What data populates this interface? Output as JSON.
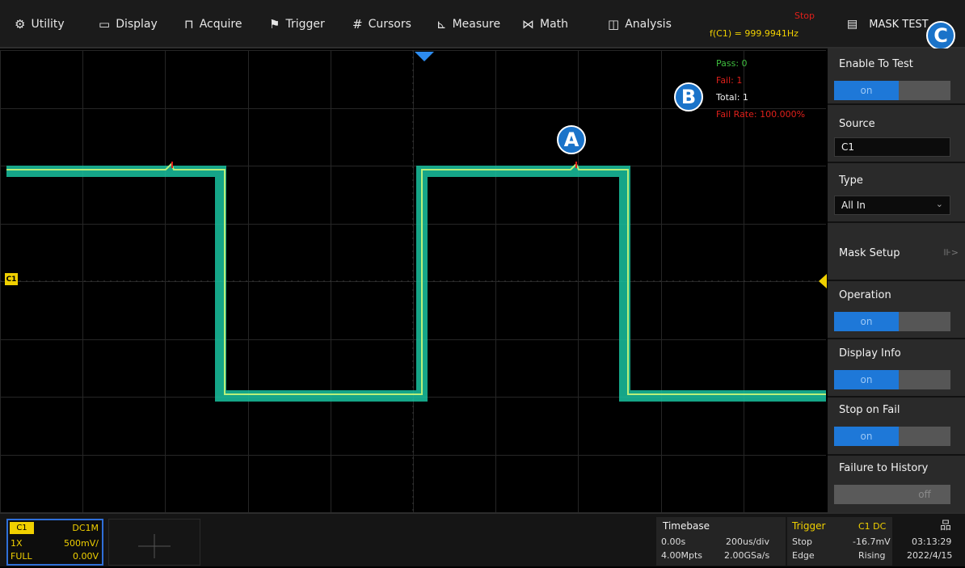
{
  "menu": {
    "items": [
      {
        "label": "Utility",
        "icon": "gear-icon",
        "glyph": "⚙"
      },
      {
        "label": "Display",
        "icon": "monitor-icon",
        "glyph": "▭"
      },
      {
        "label": "Acquire",
        "icon": "acquire-icon",
        "glyph": "⊓"
      },
      {
        "label": "Trigger",
        "icon": "flag-icon",
        "glyph": "⚑"
      },
      {
        "label": "Cursors",
        "icon": "cursors-icon",
        "glyph": "#"
      },
      {
        "label": "Measure",
        "icon": "measure-icon",
        "glyph": "⊾"
      },
      {
        "label": "Math",
        "icon": "math-icon",
        "glyph": "⋈"
      },
      {
        "label": "Analysis",
        "icon": "analysis-icon",
        "glyph": "◫"
      }
    ]
  },
  "status": {
    "run_state": "Stop",
    "frequency": "f(C1) = 999.9941Hz"
  },
  "panel": {
    "title": "MASK TEST",
    "enable_to_test": {
      "label": "Enable To Test",
      "on": "on",
      "off": ""
    },
    "source": {
      "label": "Source",
      "value": "C1"
    },
    "type": {
      "label": "Type",
      "value": "All In"
    },
    "mask_setup": {
      "label": "Mask Setup",
      "arrow": "⊪>"
    },
    "operation": {
      "label": "Operation",
      "on": "on",
      "off": ""
    },
    "display_info": {
      "label": "Display Info",
      "on": "on",
      "off": ""
    },
    "stop_on_fail": {
      "label": "Stop on Fail",
      "on": "on",
      "off": ""
    },
    "failure_to_history": {
      "label": "Failure to History",
      "on": "",
      "off": "off"
    }
  },
  "mask_stats": {
    "pass": "Pass: 0",
    "fail": "Fail: 1",
    "total": "Total: 1",
    "fail_rate": "Fail Rate: 100.000%"
  },
  "callouts": {
    "a": "A",
    "b": "B",
    "c": "C"
  },
  "channel": {
    "name": "C1",
    "coupling": "DC1M",
    "probe": "1X",
    "scale": "500mV/",
    "bandwidth": "FULL",
    "offset": "0.00V"
  },
  "timebase": {
    "label": "Timebase",
    "delay": "0.00s",
    "scale": "200us/div",
    "memory": "4.00Mpts",
    "sample_rate": "2.00GSa/s"
  },
  "trigger": {
    "label": "Trigger",
    "source": "C1 DC",
    "state": "Stop",
    "level": "-16.7mV",
    "type": "Edge",
    "slope": "Rising"
  },
  "clock": {
    "time": "03:13:29",
    "date": "2022/4/15"
  },
  "colors": {
    "background": "#000000",
    "waveform": "#19c2a0",
    "waveform_core": "#b8f07a",
    "channel": "#f0d000",
    "accent_blue": "#1e78d8",
    "fail_red": "#e0201b",
    "pass_green": "#3fbf3f"
  }
}
